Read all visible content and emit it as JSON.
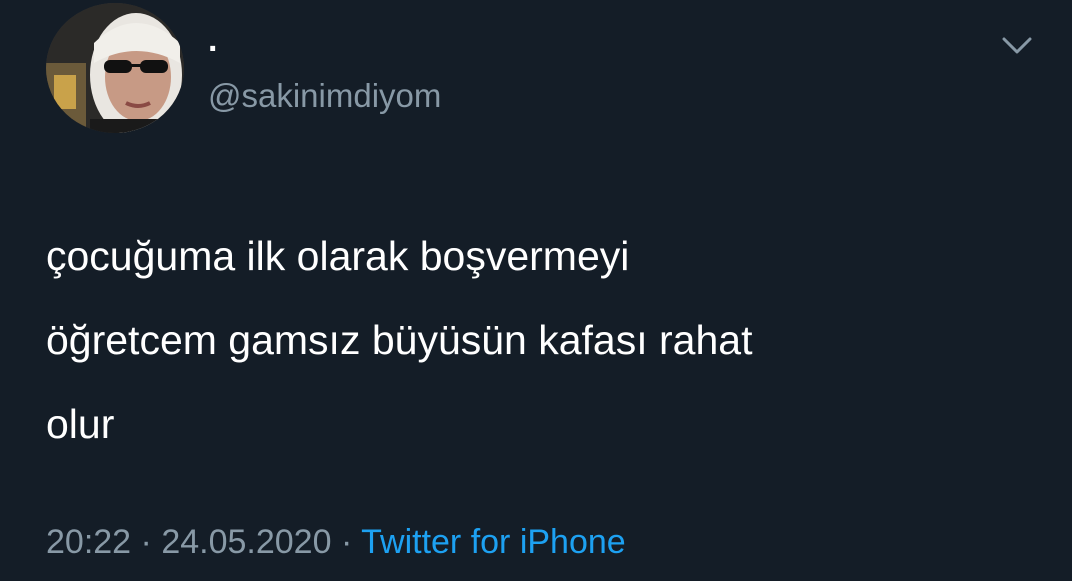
{
  "user": {
    "display_name": ".",
    "handle": "@sakinimdiyom",
    "avatar_icon": "profile-photo"
  },
  "menu_icon": "chevron-down-icon",
  "tweet": {
    "lines": [
      "çocuğuma ilk olarak boşvermeyi",
      "öğretcem gamsız büyüsün kafası rahat",
      "olur"
    ]
  },
  "meta": {
    "time": "20:22",
    "separator": "·",
    "date": "24.05.2020",
    "source": "Twitter for iPhone"
  },
  "colors": {
    "background": "#141d27",
    "text": "#ffffff",
    "secondary_text": "#8899a6",
    "link": "#1da1f2"
  }
}
